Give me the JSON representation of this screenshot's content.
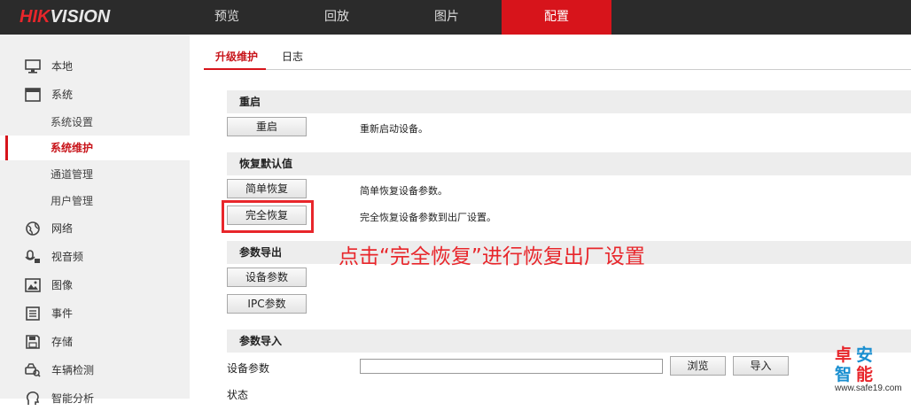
{
  "logo": {
    "brand_red": "HIK",
    "brand_white": "VISION"
  },
  "nav": [
    {
      "label": "预览"
    },
    {
      "label": "回放"
    },
    {
      "label": "图片"
    },
    {
      "label": "配置",
      "active": true
    }
  ],
  "sidebar": {
    "items": [
      {
        "label": "本地",
        "icon": "monitor-icon"
      },
      {
        "label": "系统",
        "icon": "window-icon"
      },
      {
        "label": "网络",
        "icon": "globe-icon"
      },
      {
        "label": "视音频",
        "icon": "microphone-icon"
      },
      {
        "label": "图像",
        "icon": "image-icon"
      },
      {
        "label": "事件",
        "icon": "list-icon"
      },
      {
        "label": "存储",
        "icon": "floppy-icon"
      },
      {
        "label": "车辆检测",
        "icon": "car-search-icon"
      },
      {
        "label": "智能分析",
        "icon": "brain-icon"
      }
    ],
    "sub_items": [
      {
        "label": "系统设置"
      },
      {
        "label": "系统维护",
        "active": true
      },
      {
        "label": "通道管理"
      },
      {
        "label": "用户管理"
      }
    ]
  },
  "tabs": [
    {
      "label": "升级维护",
      "active": true
    },
    {
      "label": "日志"
    }
  ],
  "sections": {
    "reboot": {
      "title": "重启",
      "button": "重启",
      "desc": "重新启动设备。"
    },
    "restore": {
      "title": "恢复默认值",
      "simple_button": "简单恢复",
      "simple_desc": "简单恢复设备参数。",
      "full_button": "完全恢复",
      "full_desc": "完全恢复设备参数到出厂设置。"
    },
    "export": {
      "title": "参数导出",
      "device_button": "设备参数",
      "ipc_button": "IPC参数"
    },
    "import": {
      "title": "参数导入",
      "label": "设备参数",
      "file_value": "",
      "browse_button": "浏览",
      "import_button": "导入",
      "status_label": "状态"
    }
  },
  "annotation": "点击“完全恢复”进行恢复出厂设置",
  "watermark": {
    "chars": [
      "卓",
      "安",
      "智",
      "能"
    ],
    "url": "www.safe19.com"
  },
  "colors": {
    "accent": "#d7141b",
    "topbar": "#2b2b2b",
    "sidebar": "#f0f0f0",
    "annotation": "#e8262b"
  }
}
